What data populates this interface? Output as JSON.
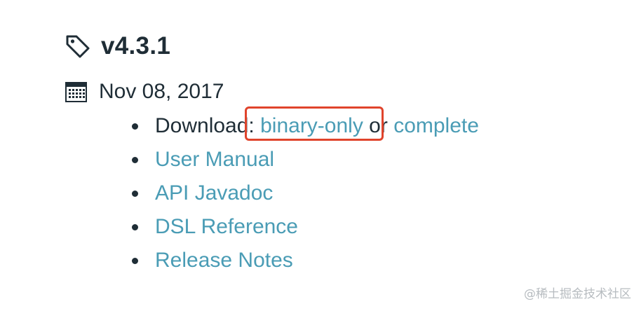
{
  "release": {
    "version": "v4.3.1",
    "date": "Nov 08, 2017",
    "icons": {
      "tag": "tag-icon",
      "date": "calendar-icon"
    }
  },
  "download": {
    "prefix": "Download: ",
    "binary_label": "binary-only",
    "separator": " or ",
    "complete_label": "complete"
  },
  "links": [
    {
      "label": "User Manual"
    },
    {
      "label": "API Javadoc"
    },
    {
      "label": "DSL Reference"
    },
    {
      "label": "Release Notes"
    }
  ],
  "annotation": {
    "color": "#e0442c",
    "target": "binary-only"
  },
  "colors": {
    "text": "#1f2d36",
    "link": "#4a9cb5"
  },
  "watermark": "@稀土掘金技术社区"
}
